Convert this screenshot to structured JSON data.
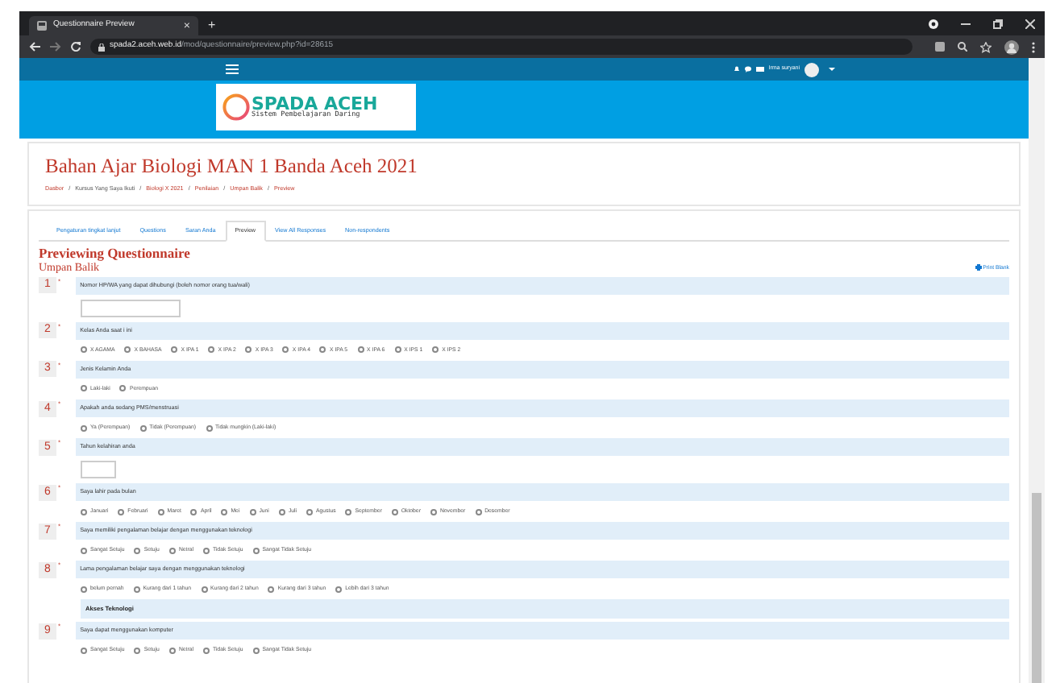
{
  "browser": {
    "tab_title": "Questionnaire Preview",
    "tab_close": "×",
    "new_tab": "+",
    "url_host": "spada2.aceh.web.id",
    "url_path": "/mod/questionnaire/preview.php?id=28615"
  },
  "navbar": {
    "user_name": "Irma suryani"
  },
  "logo": {
    "title": "SPADA ACEH",
    "subtitle": "Sistem Pembelajaran Daring"
  },
  "course": {
    "title": "Bahan Ajar Biologi MAN 1 Banda Aceh 2021",
    "separator": "/",
    "breadcrumb": [
      {
        "label": "Dasbor",
        "link": true
      },
      {
        "label": "Kursus Yang Saya Ikuti",
        "link": false
      },
      {
        "label": "Biologi X 2021",
        "link": true
      },
      {
        "label": "Penilaian",
        "link": true
      },
      {
        "label": "Umpan Balik",
        "link": true
      },
      {
        "label": "Preview",
        "link": true
      }
    ]
  },
  "tabs": [
    {
      "label": "Pengaturan tingkat lanjut",
      "selected": false
    },
    {
      "label": "Questions",
      "selected": false
    },
    {
      "label": "Saran Anda",
      "selected": false
    },
    {
      "label": "Preview",
      "selected": true
    },
    {
      "label": "View All Responses",
      "selected": false
    },
    {
      "label": "Non-respondents",
      "selected": false
    }
  ],
  "heading": "Previewing Questionnaire",
  "subheading": "Umpan Balik",
  "print_link": "Print Blank",
  "questions": [
    {
      "kind": "text",
      "number": "1",
      "mark": "*",
      "prompt": "Nomor HP/WA yang dapat dihubungi (boleh nomor orang tua/wali)"
    },
    {
      "kind": "radio",
      "number": "2",
      "mark": "*",
      "prompt": "Kelas Anda saat i ini",
      "options": [
        {
          "label": "X AGAMA",
          "checked": false
        },
        {
          "label": "X BAHASA",
          "checked": false
        },
        {
          "label": "X IPA 1",
          "checked": false
        },
        {
          "label": "X IPA 2",
          "checked": false
        },
        {
          "label": "X IPA 3",
          "checked": false
        },
        {
          "label": "X IPA 4",
          "checked": false
        },
        {
          "label": "X IPA 5",
          "checked": false
        },
        {
          "label": "X IPA 6",
          "checked": false
        },
        {
          "label": "X IPS 1",
          "checked": false
        },
        {
          "label": "X IPS 2",
          "checked": false
        }
      ]
    },
    {
      "kind": "radio",
      "number": "3",
      "mark": "*",
      "prompt": "Jenis Kelamin Anda",
      "options": [
        {
          "label": "Laki-laki",
          "checked": false
        },
        {
          "label": "Perempuan",
          "checked": false
        }
      ]
    },
    {
      "kind": "radio",
      "number": "4",
      "mark": "*",
      "prompt": "Apakah anda sedang PMS/menstruasi",
      "options": [
        {
          "label": "Ya (Perempuan)",
          "checked": false
        },
        {
          "label": "Tidak (Perempuan)",
          "checked": false
        },
        {
          "label": "Tidak mungkin (Laki-laki)",
          "checked": false
        }
      ]
    },
    {
      "kind": "year",
      "number": "5",
      "mark": "*",
      "prompt": "Tahun kelahiran anda"
    },
    {
      "kind": "radio",
      "number": "6",
      "mark": "*",
      "prompt": "Saya lahir pada bulan",
      "options": [
        {
          "label": "Januari",
          "checked": false
        },
        {
          "label": "Februari",
          "checked": false
        },
        {
          "label": "Maret",
          "checked": false
        },
        {
          "label": "April",
          "checked": false
        },
        {
          "label": "Mei",
          "checked": false
        },
        {
          "label": "Juni",
          "checked": false
        },
        {
          "label": "Juli",
          "checked": false
        },
        {
          "label": "Agustus",
          "checked": false
        },
        {
          "label": "September",
          "checked": false
        },
        {
          "label": "Oktober",
          "checked": false
        },
        {
          "label": "November",
          "checked": false
        },
        {
          "label": "Desember",
          "checked": false
        }
      ]
    },
    {
      "kind": "radio",
      "number": "7",
      "mark": "*",
      "prompt": "Saya memiliki pengalaman belajar dengan menggunakan teknologi",
      "options": [
        {
          "label": "Sangat Setuju",
          "checked": false
        },
        {
          "label": "Setuju",
          "checked": false
        },
        {
          "label": "Netral",
          "checked": false
        },
        {
          "label": "Tidak Setuju",
          "checked": false
        },
        {
          "label": "Sangat Tidak Setuju",
          "checked": false
        }
      ]
    },
    {
      "kind": "radio",
      "number": "8",
      "mark": "*",
      "prompt": "Lama pengalaman belajar saya dengan menggunakan teknologi",
      "options": [
        {
          "label": "belum pernah",
          "checked": false
        },
        {
          "label": "Kurang dari 1 tahun",
          "checked": false
        },
        {
          "label": "Kurang dari 2 tahun",
          "checked": false
        },
        {
          "label": "Kurang dari 3 tahun",
          "checked": false
        },
        {
          "label": "Lebih dari 3 tahun",
          "checked": false
        }
      ]
    },
    {
      "kind": "label",
      "prompt": "Akses Teknologi"
    },
    {
      "kind": "radio",
      "number": "9",
      "mark": "*",
      "prompt": "Saya dapat menggunakan komputer",
      "options": [
        {
          "label": "Sangat Setuju",
          "checked": false
        },
        {
          "label": "Setuju",
          "checked": false
        },
        {
          "label": "Netral",
          "checked": false
        },
        {
          "label": "Tidak Setuju",
          "checked": false
        },
        {
          "label": "Sangat Tidak Setuju",
          "checked": false
        }
      ]
    }
  ]
}
